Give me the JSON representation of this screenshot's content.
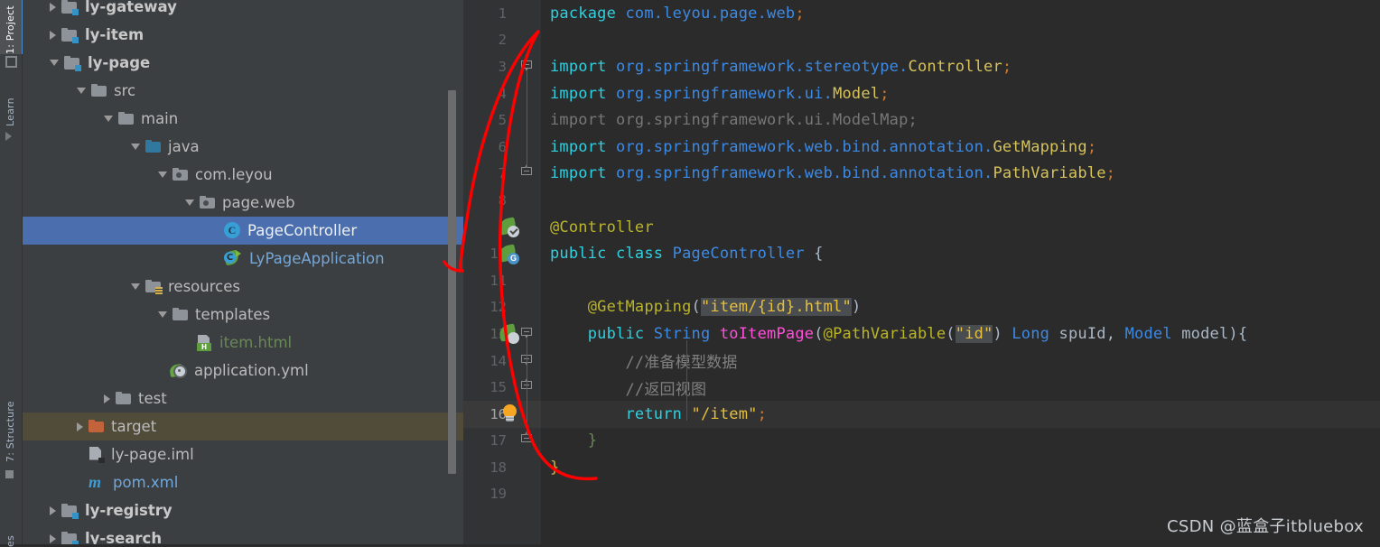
{
  "toolwindows": {
    "project_label": "1: Project",
    "learn_label": "Learn",
    "structure_label": "7: Structure",
    "favorites_label": "es"
  },
  "project_tree": {
    "nodes": [
      {
        "label": "ly-gateway",
        "indent": 0,
        "arrow": "right",
        "icon": "module-folder-icon",
        "style": "bold",
        "state": "normal"
      },
      {
        "label": "ly-item",
        "indent": 0,
        "arrow": "right",
        "icon": "module-folder-icon",
        "style": "bold",
        "state": "normal"
      },
      {
        "label": "ly-page",
        "indent": 0,
        "arrow": "down",
        "icon": "module-folder-icon",
        "style": "bold",
        "state": "normal"
      },
      {
        "label": "src",
        "indent": 1,
        "arrow": "down",
        "icon": "folder-icon",
        "style": "",
        "state": "normal"
      },
      {
        "label": "main",
        "indent": 2,
        "arrow": "down",
        "icon": "folder-icon",
        "style": "",
        "state": "normal"
      },
      {
        "label": "java",
        "indent": 3,
        "arrow": "down",
        "icon": "source-folder-icon",
        "style": "",
        "state": "normal"
      },
      {
        "label": "com.leyou",
        "indent": 4,
        "arrow": "down",
        "icon": "package-icon",
        "style": "",
        "state": "normal"
      },
      {
        "label": "page.web",
        "indent": 5,
        "arrow": "down",
        "icon": "package-icon",
        "style": "",
        "state": "normal"
      },
      {
        "label": "PageController",
        "indent": 6,
        "arrow": "none",
        "icon": "java-class-icon",
        "style": "",
        "state": "selected"
      },
      {
        "label": "LyPageApplication",
        "indent": 6,
        "arrow": "none",
        "icon": "spring-boot-app-icon",
        "style": "blue",
        "state": "normal"
      },
      {
        "label": "resources",
        "indent": 3,
        "arrow": "down",
        "icon": "resources-folder-icon",
        "style": "",
        "state": "normal"
      },
      {
        "label": "templates",
        "indent": 4,
        "arrow": "down",
        "icon": "folder-icon",
        "style": "",
        "state": "normal"
      },
      {
        "label": "item.html",
        "indent": 5,
        "arrow": "none",
        "icon": "html-file-icon",
        "style": "green",
        "state": "normal"
      },
      {
        "label": "application.yml",
        "indent": 4,
        "arrow": "none",
        "icon": "spring-yaml-icon",
        "style": "",
        "state": "normal"
      },
      {
        "label": "test",
        "indent": 2,
        "arrow": "right",
        "icon": "folder-icon",
        "style": "",
        "state": "normal"
      },
      {
        "label": "target",
        "indent": 1,
        "arrow": "right",
        "icon": "target-folder-icon",
        "style": "",
        "state": "excluded"
      },
      {
        "label": "ly-page.iml",
        "indent": 1,
        "arrow": "none",
        "icon": "iml-file-icon",
        "style": "",
        "state": "normal"
      },
      {
        "label": "pom.xml",
        "indent": 1,
        "arrow": "none",
        "icon": "maven-file-icon",
        "style": "lblue",
        "state": "normal"
      },
      {
        "label": "ly-registry",
        "indent": 0,
        "arrow": "right",
        "icon": "module-folder-icon",
        "style": "bold",
        "state": "normal"
      },
      {
        "label": "ly-search",
        "indent": 0,
        "arrow": "right",
        "icon": "module-folder-icon",
        "style": "bold",
        "state": "normal"
      }
    ]
  },
  "editor": {
    "file": "PageController.java",
    "current_line": 16,
    "lines": [
      {
        "n": 1,
        "tokens": [
          {
            "t": "package ",
            "c": "kw2"
          },
          {
            "t": "com.leyou.page.web",
            "c": "pkg"
          },
          {
            "t": ";",
            "c": "semi"
          }
        ]
      },
      {
        "n": 2,
        "tokens": []
      },
      {
        "n": 3,
        "tokens": [
          {
            "t": "import ",
            "c": "kw2"
          },
          {
            "t": "org.springframework.stereotype.",
            "c": "pkg"
          },
          {
            "t": "Controller",
            "c": "cls"
          },
          {
            "t": ";",
            "c": "semi"
          }
        ]
      },
      {
        "n": 4,
        "tokens": [
          {
            "t": "import ",
            "c": "kw2"
          },
          {
            "t": "org.springframework.ui.",
            "c": "pkg"
          },
          {
            "t": "Model",
            "c": "cls"
          },
          {
            "t": ";",
            "c": "semi"
          }
        ]
      },
      {
        "n": 5,
        "tokens": [
          {
            "t": "import org.springframework.ui.ModelMap;",
            "c": "grey"
          }
        ]
      },
      {
        "n": 6,
        "tokens": [
          {
            "t": "import ",
            "c": "kw2"
          },
          {
            "t": "org.springframework.web.bind.annotation.",
            "c": "pkg"
          },
          {
            "t": "GetMapping",
            "c": "cls"
          },
          {
            "t": ";",
            "c": "semi"
          }
        ]
      },
      {
        "n": 7,
        "tokens": [
          {
            "t": "import ",
            "c": "kw2"
          },
          {
            "t": "org.springframework.web.bind.annotation.",
            "c": "pkg"
          },
          {
            "t": "PathVariable",
            "c": "cls"
          },
          {
            "t": ";",
            "c": "semi"
          }
        ]
      },
      {
        "n": 8,
        "tokens": []
      },
      {
        "n": 9,
        "tokens": [
          {
            "t": "@Controller",
            "c": "anno"
          }
        ]
      },
      {
        "n": 10,
        "tokens": [
          {
            "t": "public ",
            "c": "kw2"
          },
          {
            "t": "class ",
            "c": "kw2"
          },
          {
            "t": "PageController",
            "c": "type"
          },
          {
            "t": " {",
            "c": "ident"
          }
        ]
      },
      {
        "n": 11,
        "tokens": []
      },
      {
        "n": 12,
        "tokens": [
          {
            "t": "    @GetMapping",
            "c": "anno"
          },
          {
            "t": "(",
            "c": "ident"
          },
          {
            "t": "\"item/{id}.html\"",
            "c": "str hl"
          },
          {
            "t": ")",
            "c": "ident"
          }
        ]
      },
      {
        "n": 13,
        "tokens": [
          {
            "t": "    public ",
            "c": "kw2"
          },
          {
            "t": "String ",
            "c": "type"
          },
          {
            "t": "toItemPage",
            "c": "mth"
          },
          {
            "t": "(",
            "c": "ident"
          },
          {
            "t": "@PathVariable",
            "c": "anno"
          },
          {
            "t": "(",
            "c": "ident"
          },
          {
            "t": "\"id\"",
            "c": "str hl"
          },
          {
            "t": ") ",
            "c": "ident"
          },
          {
            "t": "Long ",
            "c": "type"
          },
          {
            "t": "spuId, ",
            "c": "par"
          },
          {
            "t": "Model ",
            "c": "type"
          },
          {
            "t": "model",
            "c": "par"
          },
          {
            "t": "){",
            "c": "ident"
          }
        ]
      },
      {
        "n": 14,
        "tokens": [
          {
            "t": "        //准备模型数据",
            "c": "cmt"
          }
        ]
      },
      {
        "n": 15,
        "tokens": [
          {
            "t": "        //返回视图",
            "c": "cmt"
          }
        ]
      },
      {
        "n": 16,
        "tokens": [
          {
            "t": "        return ",
            "c": "kw2"
          },
          {
            "t": "\"/item\"",
            "c": "str"
          },
          {
            "t": ";",
            "c": "semi"
          }
        ]
      },
      {
        "n": 17,
        "tokens": [
          {
            "t": "    }",
            "c": "brace-g"
          }
        ]
      },
      {
        "n": 18,
        "tokens": [
          {
            "t": "}",
            "c": "brace-y"
          }
        ]
      },
      {
        "n": 19,
        "tokens": []
      }
    ],
    "gutter_icons": [
      {
        "line": 9,
        "icon": "spring-bean-check-icon",
        "badge": "check"
      },
      {
        "line": 10,
        "icon": "spring-bean-icon",
        "badge": "bean"
      },
      {
        "line": 13,
        "icon": "spring-request-mapping-icon",
        "badge": "map"
      }
    ],
    "intention_bulb": {
      "line": 16,
      "icon": "lightbulb-icon"
    }
  },
  "annotation": {
    "color": "#ff0000",
    "name": "red-highlight-curve"
  },
  "watermark": {
    "text": "CSDN @蓝盒子itbluebox"
  }
}
